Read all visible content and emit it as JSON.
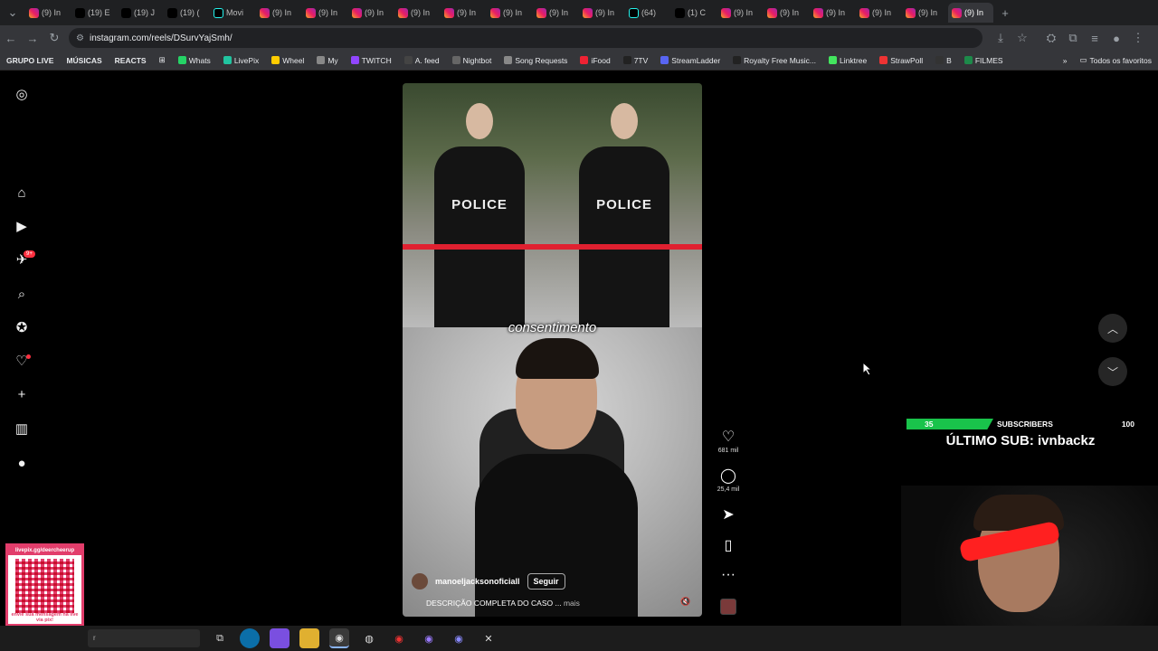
{
  "browser": {
    "tabs": [
      {
        "label": "(9) In",
        "icon": "instagram-icon"
      },
      {
        "label": "(19) E",
        "icon": "x-icon"
      },
      {
        "label": "(19) J",
        "icon": "x-icon"
      },
      {
        "label": "(19) (",
        "icon": "x-icon"
      },
      {
        "label": "Movi",
        "icon": "tiktok-icon"
      },
      {
        "label": "(9) In",
        "icon": "instagram-icon"
      },
      {
        "label": "(9) In",
        "icon": "instagram-icon"
      },
      {
        "label": "(9) In",
        "icon": "instagram-icon"
      },
      {
        "label": "(9) In",
        "icon": "instagram-icon"
      },
      {
        "label": "(9) In",
        "icon": "instagram-icon"
      },
      {
        "label": "(9) In",
        "icon": "instagram-icon"
      },
      {
        "label": "(9) In",
        "icon": "instagram-icon"
      },
      {
        "label": "(9) In",
        "icon": "instagram-icon"
      },
      {
        "label": "(64)",
        "icon": "tiktok-icon"
      },
      {
        "label": "(1) C",
        "icon": "x-icon"
      },
      {
        "label": "(9) In",
        "icon": "instagram-icon"
      },
      {
        "label": "(9) In",
        "icon": "instagram-icon"
      },
      {
        "label": "(9) In",
        "icon": "instagram-icon"
      },
      {
        "label": "(9) In",
        "icon": "instagram-icon"
      },
      {
        "label": "(9) In",
        "icon": "instagram-icon"
      },
      {
        "label": "(9) In",
        "icon": "instagram-icon"
      }
    ],
    "url": "instagram.com/reels/DSurvYajSmh/",
    "bookmarks": [
      "GRUPO LIVE",
      "MÚSICAS",
      "REACTS",
      "Whats",
      "LivePix",
      "Wheel",
      "My",
      "TWITCH",
      "A. feed",
      "Nightbot",
      "Song Requests",
      "iFood",
      "7TV",
      "StreamLadder",
      "Royalty Free Music...",
      "Linktree",
      "StrawPoll",
      "B",
      "FILMES"
    ],
    "all_bookmarks": "Todos os favoritos"
  },
  "sidebar": {
    "notifications_badge": "9+"
  },
  "reel": {
    "police_text_left": "POLICE",
    "police_text_right": "POLICE",
    "caption": "consentimento",
    "author": "manoeljacksonoficiall",
    "follow_label": "Seguir",
    "description": "DESCRIÇÃO COMPLETA DO CASO ...",
    "more_label": "mais",
    "likes": "681 mil",
    "comments": "25,4 mil"
  },
  "stream_overlay": {
    "sub_current": "35",
    "sub_label": "SUBSCRIBERS",
    "sub_goal": "100",
    "last_sub": "ÚLTIMO SUB: ivnbackz",
    "qr_top": "livepix.gg/deercheerup",
    "qr_bottom": "envie sua mensagem na live via pix!"
  },
  "taskbar": {
    "search_placeholder": "r"
  }
}
